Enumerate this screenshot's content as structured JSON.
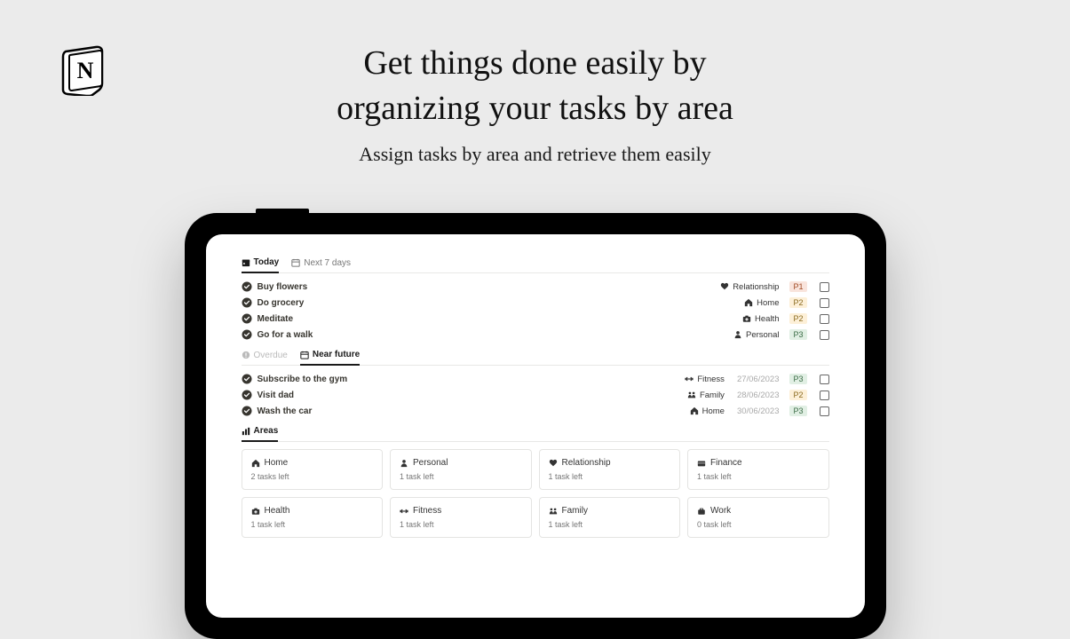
{
  "headline_line1": "Get things done easily by",
  "headline_line2": "organizing your tasks by area",
  "subhead": "Assign tasks by area and retrieve them easily",
  "tabs1": {
    "today": "Today",
    "next7": "Next 7 days"
  },
  "today_tasks": [
    {
      "title": "Buy flowers",
      "area": "Relationship",
      "area_icon": "heart",
      "priority": "P1",
      "pclass": "p1"
    },
    {
      "title": "Do grocery",
      "area": "Home",
      "area_icon": "home",
      "priority": "P2",
      "pclass": "p2"
    },
    {
      "title": "Meditate",
      "area": "Health",
      "area_icon": "medkit",
      "priority": "P2",
      "pclass": "p2"
    },
    {
      "title": "Go for a walk",
      "area": "Personal",
      "area_icon": "person",
      "priority": "P3",
      "pclass": "p3"
    }
  ],
  "tabs2": {
    "overdue": "Overdue",
    "near": "Near future"
  },
  "near_tasks": [
    {
      "title": "Subscribe to the gym",
      "area": "Fitness",
      "area_icon": "dumbbell",
      "date": "27/06/2023",
      "priority": "P3",
      "pclass": "p3"
    },
    {
      "title": "Visit dad",
      "area": "Family",
      "area_icon": "family",
      "date": "28/06/2023",
      "priority": "P2",
      "pclass": "p2"
    },
    {
      "title": "Wash the car",
      "area": "Home",
      "area_icon": "home",
      "date": "30/06/2023",
      "priority": "P3",
      "pclass": "p3"
    }
  ],
  "tabs3": {
    "areas": "Areas"
  },
  "area_cards": [
    {
      "name": "Home",
      "icon": "home",
      "sub": "2 tasks left"
    },
    {
      "name": "Personal",
      "icon": "person",
      "sub": "1 task left"
    },
    {
      "name": "Relationship",
      "icon": "heart",
      "sub": "1 task left"
    },
    {
      "name": "Finance",
      "icon": "finance",
      "sub": "1 task left"
    },
    {
      "name": "Health",
      "icon": "medkit",
      "sub": "1 task left"
    },
    {
      "name": "Fitness",
      "icon": "dumbbell",
      "sub": "1 task left"
    },
    {
      "name": "Family",
      "icon": "family",
      "sub": "1 task left"
    },
    {
      "name": "Work",
      "icon": "work",
      "sub": "0 task left"
    }
  ]
}
